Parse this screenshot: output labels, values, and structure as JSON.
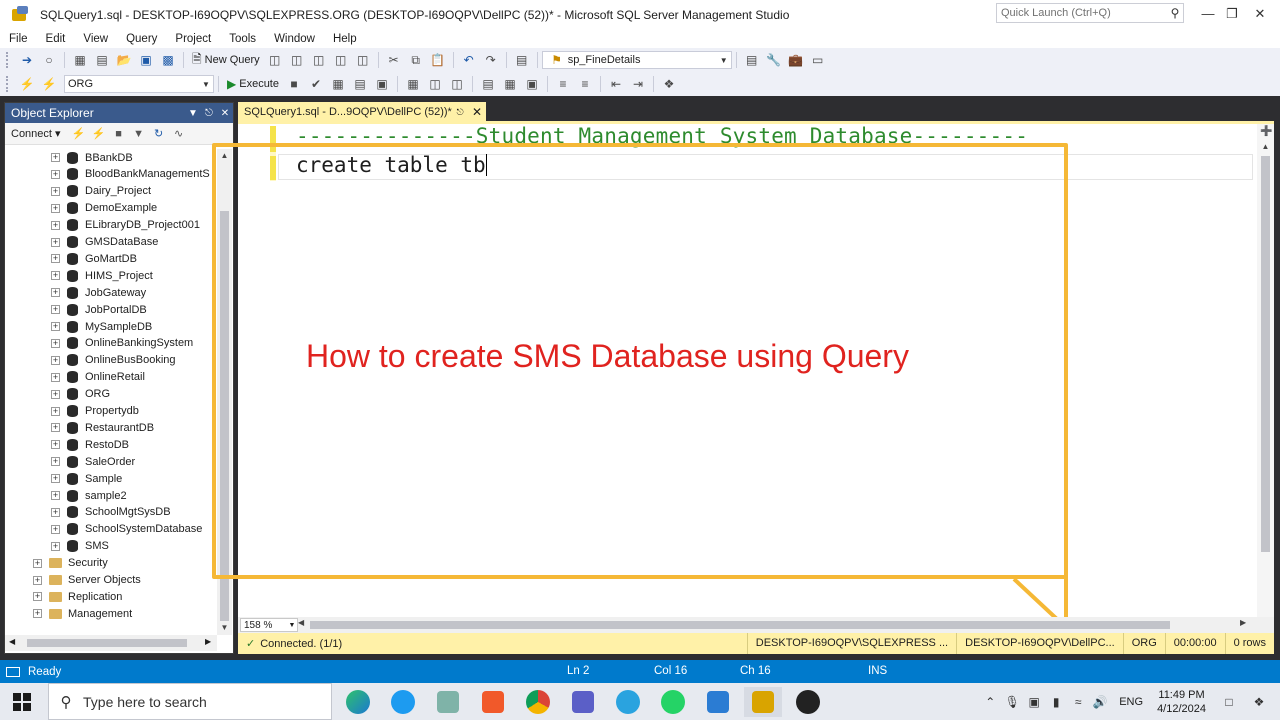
{
  "window": {
    "title": "SQLQuery1.sql - DESKTOP-I69OQPV\\SQLEXPRESS.ORG (DESKTOP-I69OQPV\\DellPC (52))* - Microsoft SQL Server Management Studio",
    "quick_launch_placeholder": "Quick Launch (Ctrl+Q)"
  },
  "menu": [
    "File",
    "Edit",
    "View",
    "Query",
    "Project",
    "Tools",
    "Window",
    "Help"
  ],
  "toolbar": {
    "new_query_label": "New Query",
    "procedure_combo": "sp_FineDetails",
    "database_combo": "ORG",
    "execute_label": "Execute"
  },
  "object_explorer": {
    "title": "Object Explorer",
    "connect_label": "Connect",
    "databases": [
      "BBankDB",
      "BloodBankManagementS",
      "Dairy_Project",
      "DemoExample",
      "ELibraryDB_Project001",
      "GMSDataBase",
      "GoMartDB",
      "HIMS_Project",
      "JobGateway",
      "JobPortalDB",
      "MySampleDB",
      "OnlineBankingSystem",
      "OnlineBusBooking",
      "OnlineRetail",
      "ORG",
      "Propertydb",
      "RestaurantDB",
      "RestoDB",
      "SaleOrder",
      "Sample",
      "sample2",
      "SchoolMgtSysDB",
      "SchoolSystemDatabase",
      "SMS"
    ],
    "folders": [
      "Security",
      "Server Objects",
      "Replication",
      "Management"
    ]
  },
  "editor": {
    "tab_title": "SQLQuery1.sql - D...9OQPV\\DellPC (52))*",
    "line1": "--------------Student Management System Database---------",
    "line2": "create table tb",
    "zoom": "158 %"
  },
  "overlay_title": "How to create SMS Database  using Query",
  "query_status": {
    "connected": "Connected. (1/1)",
    "server": "DESKTOP-I69OQPV\\SQLEXPRESS ...",
    "user": "DESKTOP-I69OQPV\\DellPC...",
    "database": "ORG",
    "elapsed": "00:00:00",
    "rows": "0 rows"
  },
  "status_bar": {
    "ready": "Ready",
    "ln": "Ln 2",
    "col": "Col 16",
    "ch": "Ch 16",
    "mode": "INS"
  },
  "taskbar": {
    "search_placeholder": "Type here to search",
    "language": "ENG",
    "time": "11:49 PM",
    "date": "4/12/2024"
  },
  "colors": {
    "accent": "#007acc",
    "title_highlight": "#e0231f",
    "frame": "#f5b836",
    "tab_yellow": "#fff1a8"
  }
}
